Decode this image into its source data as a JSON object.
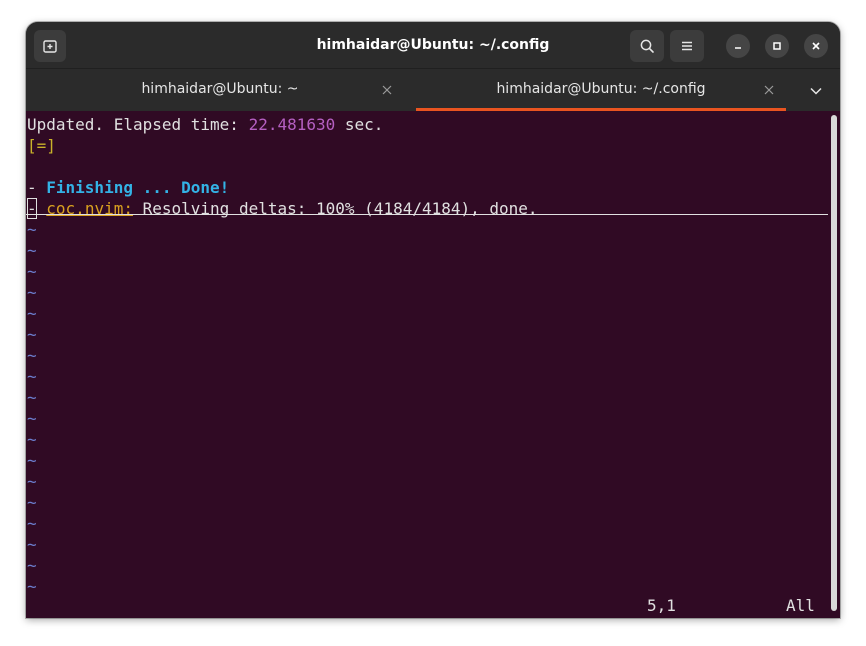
{
  "window": {
    "title": "himhaidar@Ubuntu: ~/.config"
  },
  "tabs": [
    {
      "label": "himhaidar@Ubuntu: ~",
      "active": false
    },
    {
      "label": "himhaidar@Ubuntu: ~/.config",
      "active": true
    }
  ],
  "colors": {
    "terminal_bg": "#300a24",
    "accent": "#e95420",
    "tilde": "#6c7fd0",
    "elapsed_value": "#b55fc2",
    "finishing": "#33b3e6",
    "plugin_name": "#d9a11f",
    "progress_bracket": "#c9b22a"
  },
  "terminal": {
    "updated_prefix": "Updated. Elapsed time: ",
    "elapsed_value": "22.481630",
    "updated_suffix": " sec.",
    "progress_open": "[",
    "progress_fill": "=",
    "progress_close": "]",
    "finish_dash": "- ",
    "finish_text": "Finishing ... Done!",
    "plugin_dash": "-",
    "plugin_space": " ",
    "plugin_name": "coc.nvim:",
    "plugin_status": " Resolving deltas: 100% (4184/4184), done.",
    "tilde": "~",
    "cursor_position": "5,1",
    "scroll_position": "All"
  },
  "icons": {
    "new_tab": "new-tab-icon",
    "search": "search-icon",
    "menu": "hamburger-menu-icon",
    "minimize": "minimize-icon",
    "maximize": "maximize-icon",
    "close": "close-icon",
    "tab_close": "close-icon",
    "tabs_dropdown": "chevron-down-icon"
  }
}
